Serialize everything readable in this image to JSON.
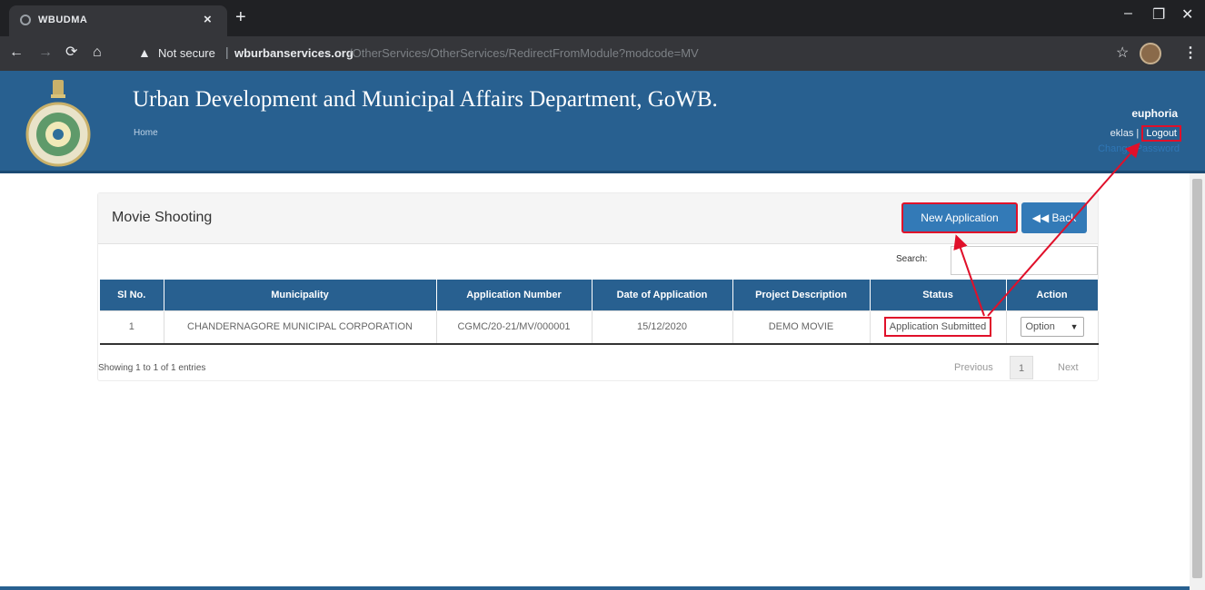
{
  "browser": {
    "tab_title": "WBUDMA",
    "security_label": "Not secure",
    "url_host": "wburbanservices.org",
    "url_path": "/OtherServices/OtherServices/RedirectFromModule?modcode=MV"
  },
  "header": {
    "title": "Urban Development and Municipal Affairs Department, GoWB.",
    "home_link": "Home",
    "user_name": "euphoria",
    "user_id": "eklas",
    "separator": "|",
    "logout_label": "Logout",
    "change_password_label": "Change Password"
  },
  "panel": {
    "title": "Movie Shooting",
    "new_application_label": "New Application",
    "back_label": "Back",
    "search_label": "Search:",
    "search_value": ""
  },
  "table": {
    "columns": [
      "Sl No.",
      "Municipality",
      "Application Number",
      "Date of Application",
      "Project Description",
      "Status",
      "Action"
    ],
    "rows": [
      {
        "sl_no": "1",
        "municipality": "CHANDERNAGORE MUNICIPAL CORPORATION",
        "application_number": "CGMC/20-21/MV/000001",
        "date": "15/12/2020",
        "project_description": "DEMO MOVIE",
        "status": "Application Submitted",
        "action": "Option"
      }
    ],
    "info": "Showing 1 to 1 of 1 entries",
    "pager": {
      "previous": "Previous",
      "page": "1",
      "next": "Next"
    }
  },
  "colors": {
    "brand": "#286090",
    "highlight": "#e0102a"
  }
}
